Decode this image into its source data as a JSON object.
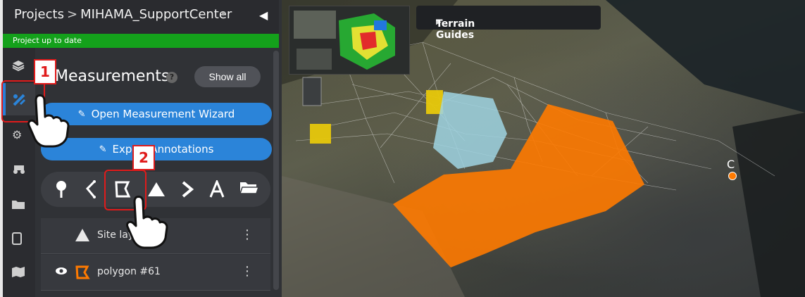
{
  "header": {
    "breadcrumb_root": "Projects",
    "breadcrumb_sep": ">",
    "project_name": "MIHAMA_SupportCenter",
    "status": "Project up to date"
  },
  "colors": {
    "status_green": "#14a11b",
    "accent_blue": "#2b84d9",
    "polygon_orange": "#ff7a00",
    "highlight_red": "#e01b1b"
  },
  "sidebar": {
    "rail_icons": [
      "layers-icon",
      "measure-icon",
      "gear-icon",
      "vehicle-icon",
      "folder-icon",
      "tablet-icon",
      "map-icon"
    ],
    "active_index": 1
  },
  "measurements": {
    "title": "Measurements",
    "show_all": "Show all",
    "open_wizard": "Open Measurement Wizard",
    "export": "Export Annotations",
    "tools": [
      "pin-tool-icon",
      "polyline-tool-icon",
      "polygon-tool-icon",
      "volume-tool-icon",
      "arrow-tool-icon",
      "text-tool-icon",
      "folder-tool-icon"
    ],
    "items": [
      {
        "name": "Site layout",
        "icon": "triangle-icon"
      },
      {
        "name": "polygon #61",
        "icon": "polygon-icon"
      }
    ]
  },
  "callouts": [
    "1",
    "2"
  ],
  "map": {
    "terrain_guides": "Terrain Guides",
    "point_label": "C"
  }
}
